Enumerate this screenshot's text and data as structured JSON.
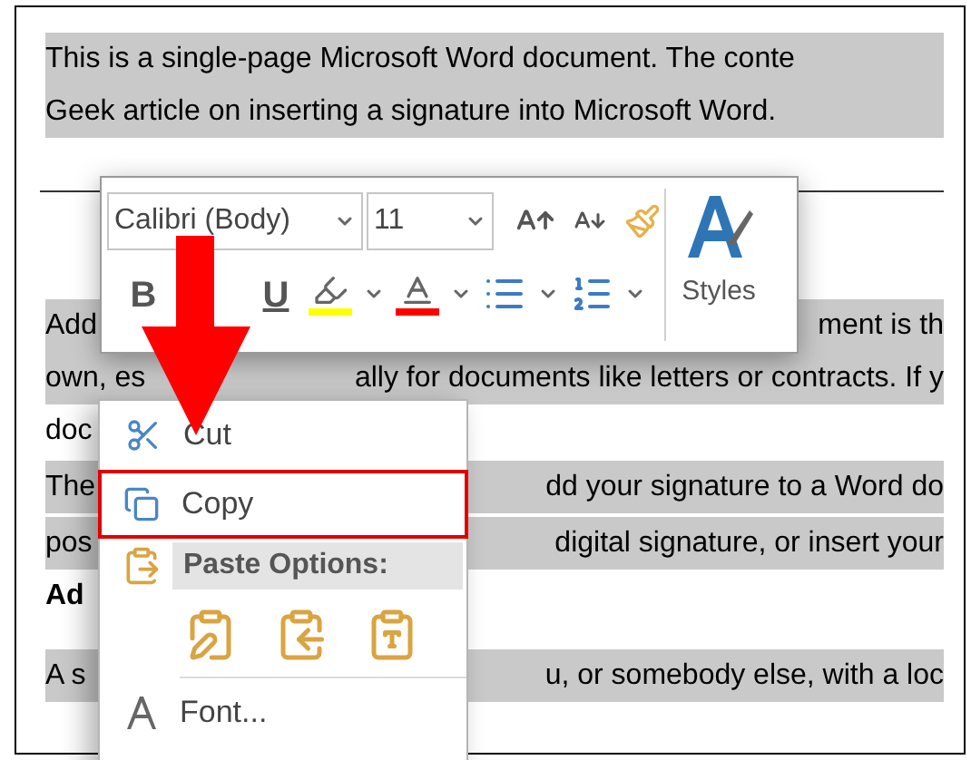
{
  "document": {
    "lines": [
      {
        "left": "This is a single-page Microsoft Word document. The conte",
        "highlighted": true,
        "bold": false
      },
      {
        "left": "Geek article on inserting a signature into Microsoft Word.",
        "highlighted": true,
        "bold": false
      },
      {
        "left": "Add",
        "right": "ment is th",
        "highlighted": true,
        "bold": false
      },
      {
        "left": "own, es",
        "right": "ally for documents like letters or contracts. If y",
        "highlighted": true,
        "bold": false
      },
      {
        "left": "doc",
        "highlighted": false,
        "bold": false
      },
      {
        "left": "The",
        "right": "dd your signature to a Word do",
        "highlighted": true,
        "bold": false
      },
      {
        "left": "pos",
        "right": "digital signature, or insert your",
        "highlighted": true,
        "bold": false
      },
      {
        "left": "Ad",
        "highlighted": false,
        "bold": true
      },
      {
        "left": "A s",
        "right": "u, or somebody else, with a loc",
        "highlighted": true,
        "bold": false
      }
    ]
  },
  "mini_toolbar": {
    "font_name": "Calibri (Body)",
    "font_size": "11",
    "bold": "B",
    "underline": "U",
    "styles": "Styles"
  },
  "context_menu": {
    "items": [
      {
        "kind": "command",
        "label": "Cut",
        "selected": false
      },
      {
        "kind": "command",
        "label": "Copy",
        "selected": true
      },
      {
        "kind": "header",
        "label": "Paste Options:"
      },
      {
        "kind": "paste_buttons"
      },
      {
        "kind": "command",
        "label": "Font...",
        "selected": false
      }
    ]
  }
}
